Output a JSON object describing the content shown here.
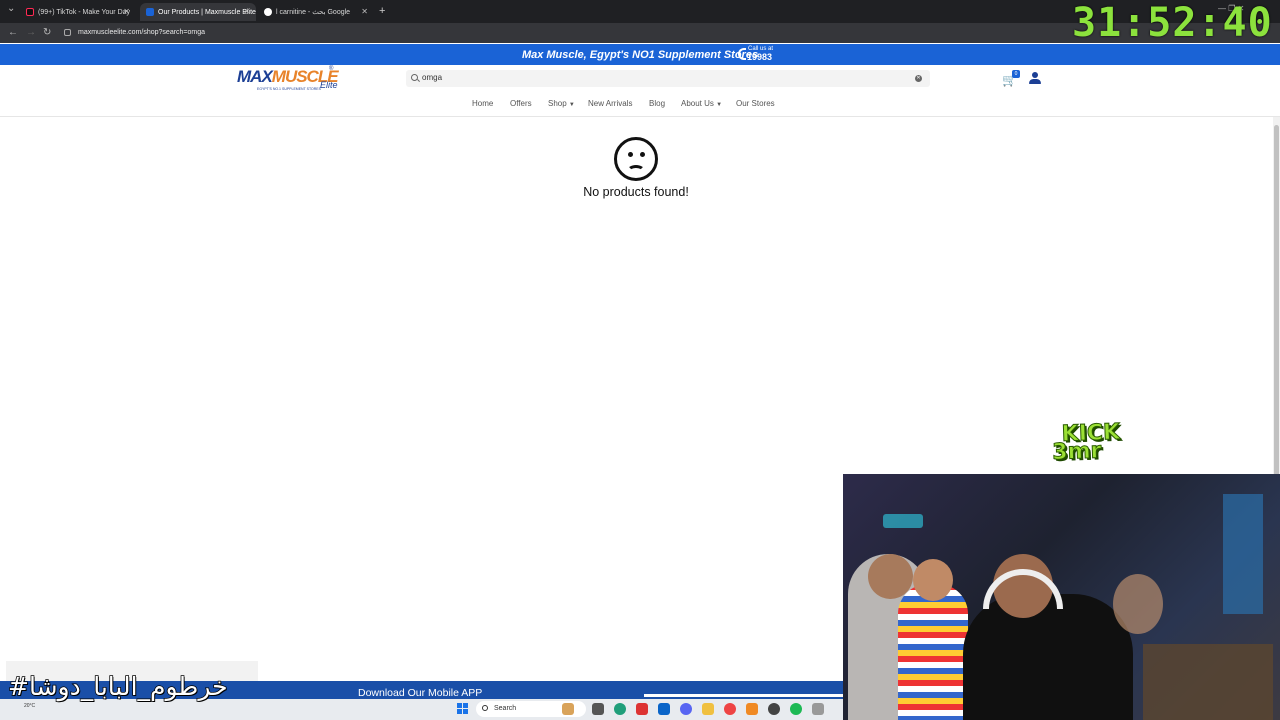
{
  "browser": {
    "tabs": [
      {
        "label": "(99+) TikTok - Make Your Day",
        "active": false
      },
      {
        "label": "Our Products | Maxmuscle Elite",
        "active": true
      },
      {
        "label": "l carnitine - بحث Google",
        "active": false
      }
    ],
    "url": "maxmuscleelite.com/shop?search=omga"
  },
  "overlay": {
    "timer": "31:52:40",
    "hashtag": "#خرطوم_البابا_دوشا",
    "kick_line1": "KICK",
    "kick_line2": "3mr"
  },
  "site": {
    "promo_text": "Max Muscle, Egypt's NO1 Supplement Stores",
    "call_us": "Call us at",
    "phone": "19983",
    "logo_text_a": "MAX",
    "logo_text_b": "MUSCLE",
    "logo_elite": "Elite",
    "logo_tagline": "EGYPT'S NO.1 SUPPLEMENT STORES",
    "search_value": "omga",
    "cart_count": "0",
    "nav": [
      {
        "label": "Home",
        "dropdown": false
      },
      {
        "label": "Offers",
        "dropdown": false
      },
      {
        "label": "Shop",
        "dropdown": true
      },
      {
        "label": "New Arrivals",
        "dropdown": false
      },
      {
        "label": "Blog",
        "dropdown": false
      },
      {
        "label": "About Us",
        "dropdown": true
      },
      {
        "label": "Our Stores",
        "dropdown": false
      }
    ],
    "empty_message": "No products found!",
    "app_banner": "Download Our Mobile APP"
  },
  "taskbar": {
    "search_label": "Search",
    "weather_temp": "20°C"
  },
  "colors": {
    "brand_blue": "#1a63d6",
    "timer_green": "#8ce23d"
  }
}
